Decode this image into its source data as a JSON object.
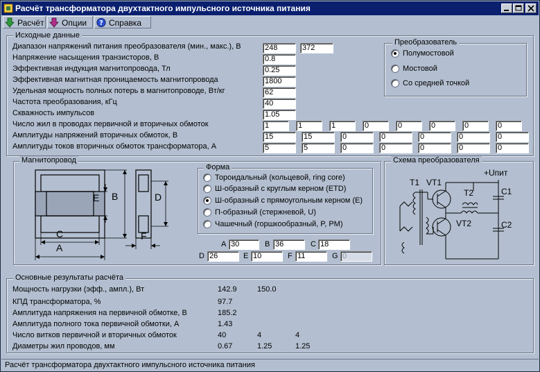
{
  "title": "Расчёт трансформатора двухтактного импульсного источника питания",
  "menu": [
    {
      "label": "Расчёт",
      "icon": "arrow-down-icon"
    },
    {
      "label": "Опции",
      "icon": "arrow-down-icon"
    },
    {
      "label": "Справка",
      "icon": "help-icon"
    }
  ],
  "input_group": {
    "title": "Исходные данные"
  },
  "inputs": [
    {
      "label": "Диапазон напряжений питания преобразователя (мин., макс.), В",
      "values": [
        "248",
        "372"
      ]
    },
    {
      "label": "Напряжение насыщения транзисторов, В",
      "values": [
        "0.8"
      ]
    },
    {
      "label": "Эффективная индукция магнитопровода, Тл",
      "values": [
        "0.25"
      ]
    },
    {
      "label": "Эффективная магнитная проницаемость магнитопровода",
      "values": [
        "1800"
      ]
    },
    {
      "label": "Удельная мощность полных потерь в магнитопроводе, Вт/кг",
      "values": [
        "62"
      ]
    },
    {
      "label": "Частота преобразования, кГц",
      "values": [
        "40"
      ]
    },
    {
      "label": "Скважность импульсов",
      "values": [
        "1.05"
      ]
    }
  ],
  "multi_inputs": [
    {
      "label": "Число жил в проводах первичной и вторичных обмоток",
      "values": [
        "1",
        "1",
        "1",
        "0",
        "0",
        "0",
        "0",
        "0"
      ]
    },
    {
      "label": "Амплитуды напряжений вторичных обмоток, В",
      "values": [
        "15",
        "15",
        "0",
        "0",
        "0",
        "0",
        "0"
      ]
    },
    {
      "label": "Амплитуды токов вторичных обмоток трансформатора, А",
      "values": [
        "5",
        "5",
        "0",
        "0",
        "0",
        "0",
        "0"
      ]
    }
  ],
  "converter": {
    "title": "Преобразователь",
    "options": [
      {
        "label": "Полумостовой",
        "selected": true
      },
      {
        "label": "Мостовой",
        "selected": false
      },
      {
        "label": "Со средней точкой",
        "selected": false
      }
    ]
  },
  "core": {
    "title": "Магнитопровод",
    "diagram_labels": {
      "A": "A",
      "B": "B",
      "C": "C",
      "D": "D",
      "E": "E",
      "F": "F"
    }
  },
  "shape": {
    "title": "Форма",
    "options": [
      {
        "label": "Тороидальный (кольцевой, ring core)",
        "selected": false
      },
      {
        "label": "Ш-образный с круглым керном (ETD)",
        "selected": false
      },
      {
        "label": "Ш-образный с прямоугольным керном (E)",
        "selected": true
      },
      {
        "label": "П-образный (стержневой, U)",
        "selected": false
      },
      {
        "label": "Чашечный (горшкообразный, P, PM)",
        "selected": false
      }
    ]
  },
  "dims": [
    {
      "label": "A",
      "value": "30",
      "disabled": false
    },
    {
      "label": "B",
      "value": "36",
      "disabled": false
    },
    {
      "label": "C",
      "value": "18",
      "disabled": false
    },
    {
      "label": "D",
      "value": "26",
      "disabled": false
    },
    {
      "label": "E",
      "value": "10",
      "disabled": false
    },
    {
      "label": "F",
      "value": "11",
      "disabled": false
    },
    {
      "label": "G",
      "value": "0",
      "disabled": true
    }
  ],
  "schematic": {
    "title": "Схема преобразователя",
    "labels": {
      "t1": "T1",
      "vt1": "VT1",
      "t2": "T2",
      "c1": "C1",
      "vt2": "VT2",
      "c2": "C2",
      "upit": "+Uпит"
    }
  },
  "results": {
    "title": "Основные результаты расчёта",
    "rows": [
      {
        "label": "Мощность нагрузки (эфф., ампл.), Вт",
        "values": [
          "142.9",
          "150.0"
        ]
      },
      {
        "label": "КПД трансформатора, %",
        "values": [
          "97.7"
        ]
      },
      {
        "label": "Амплитуда напряжения на первичной обмотке, В",
        "values": [
          "185.2"
        ]
      },
      {
        "label": "Амплитуда полного тока первичной обмотки, А",
        "values": [
          "1.43"
        ]
      },
      {
        "label": "Число витков первичной и вторичных обмоток",
        "values": [
          "40",
          "4",
          "4"
        ]
      },
      {
        "label": "Диаметры жил проводов, мм",
        "values": [
          "0.67",
          "1.25",
          "1.25"
        ]
      }
    ]
  },
  "status": "Расчёт трансформатора двухтактного импульсного источника питания",
  "colors": {
    "titlebar": "#0a1f6e",
    "window": "#b3bfd0",
    "desktop": "#3d5a82"
  }
}
